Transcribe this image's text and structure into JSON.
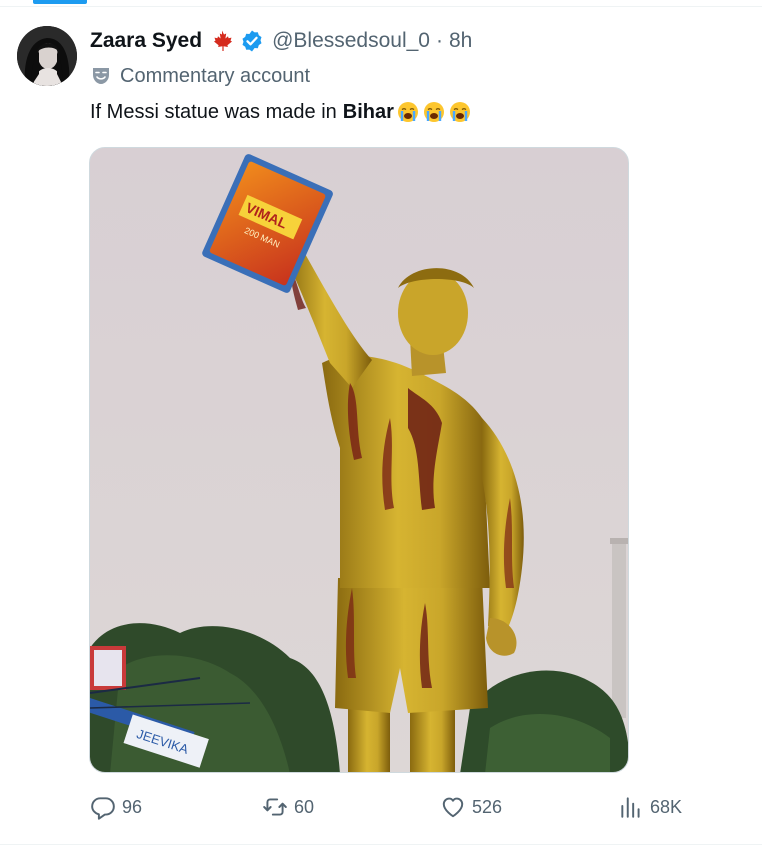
{
  "tweet": {
    "author_name": "Zaara Syed",
    "handle": "@Blessedsoul_0",
    "separator": "·",
    "time": "8h",
    "label": "Commentary account",
    "text_prefix": "If Messi statue was made in",
    "text_bold": "Bihar",
    "emojis": [
      "loudly-crying-face",
      "loudly-crying-face",
      "loudly-crying-face"
    ],
    "flag_icon": "maple-leaf-icon",
    "verified_color": "#1d9bf0"
  },
  "media": {
    "packet_brand": "VIMAL",
    "packet_tag": "200 MAN",
    "banner_text": "JEEVIKA"
  },
  "actions": {
    "replies": "96",
    "reposts": "60",
    "likes": "526",
    "views": "68K"
  },
  "colors": {
    "accent": "#1d9bf0",
    "secondary_text": "#536471",
    "primary_text": "#0f1419",
    "flag_red": "#d52b1e"
  }
}
